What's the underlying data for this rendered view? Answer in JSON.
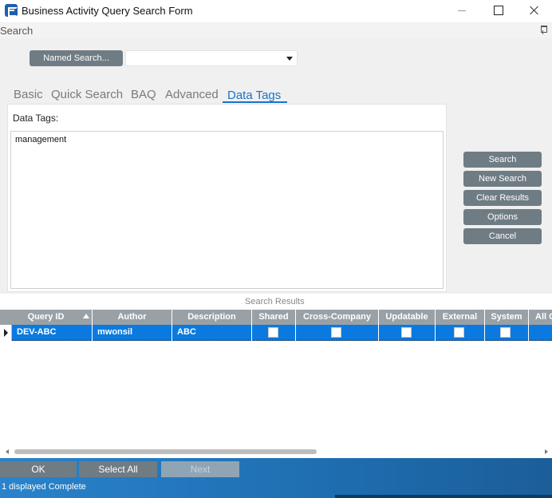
{
  "window": {
    "title": "Business Activity Query Search Form"
  },
  "search_header": {
    "label": "Search"
  },
  "named_search": {
    "button_label": "Named Search...",
    "selected_value": ""
  },
  "tabs": [
    {
      "label": "Basic",
      "active": false
    },
    {
      "label": "Quick Search",
      "active": false
    },
    {
      "label": "BAQ",
      "active": false
    },
    {
      "label": "Advanced",
      "active": false
    },
    {
      "label": "Data Tags",
      "active": true
    }
  ],
  "data_tags": {
    "label": "Data Tags:",
    "value": "management"
  },
  "actions": {
    "search": "Search",
    "new_search": "New Search",
    "clear_results": "Clear Results",
    "options": "Options",
    "cancel": "Cancel"
  },
  "results": {
    "label": "Search Results",
    "columns": [
      "Query ID",
      "Author",
      "Description",
      "Shared",
      "Cross-Company",
      "Updatable",
      "External",
      "System",
      "All C"
    ],
    "rows": [
      {
        "query_id": "DEV-ABC",
        "author": "mwonsil",
        "description": "ABC",
        "shared": false,
        "cross_company": false,
        "updatable": false,
        "external": false,
        "system": false
      }
    ]
  },
  "footer": {
    "ok": "OK",
    "select_all": "Select All",
    "next": "Next",
    "status": "1 displayed Complete"
  },
  "colors": {
    "accent": "#1a73c7",
    "selected_row": "#0a7ae0",
    "button": "#6f7c84",
    "footer": "#2a83cb"
  }
}
